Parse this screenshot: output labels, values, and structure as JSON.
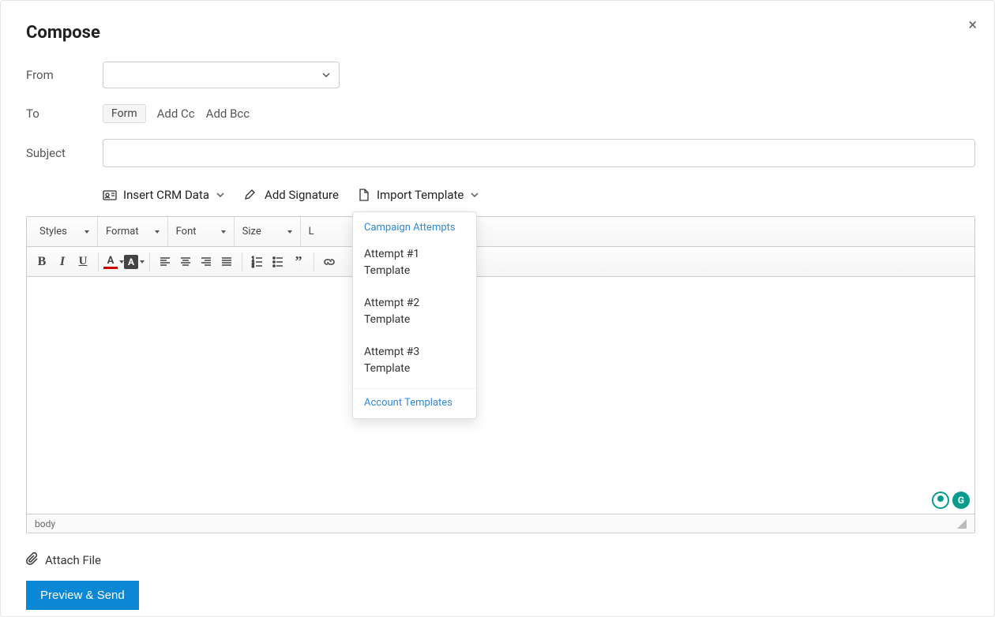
{
  "title": "Compose",
  "labels": {
    "from": "From",
    "to": "To",
    "subject": "Subject"
  },
  "to_chip": "Form",
  "cc_label": "Add Cc",
  "bcc_label": "Add Bcc",
  "subject_value": "",
  "actions": {
    "insert_crm": "Insert CRM Data",
    "add_signature": "Add Signature",
    "import_template": "Import Template"
  },
  "template_menu": {
    "header": "Campaign Attempts",
    "items": [
      "Attempt #1 Template",
      "Attempt #2 Template",
      "Attempt #3 Template"
    ],
    "footer": "Account Templates"
  },
  "toolbar": {
    "styles": "Styles",
    "format": "Format",
    "font": "Font",
    "size": "Size",
    "line": "L"
  },
  "editor_status": "body",
  "attach_label": "Attach File",
  "primary_button": "Preview & Send",
  "assist_badge_letter": "G"
}
